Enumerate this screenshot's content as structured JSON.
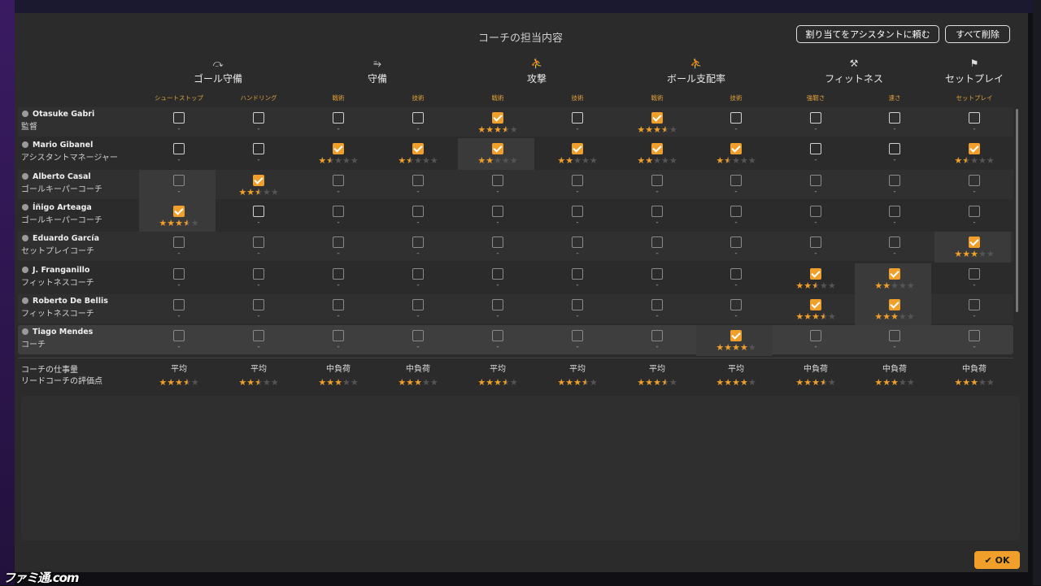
{
  "title": "コーチの担当内容",
  "buttons": {
    "assign_assistant": "割り当てをアシスタントに頼む",
    "delete_all": "すべて削除",
    "ok": "OK",
    "ok_icon": "✔"
  },
  "watermark": "ファミ通.com",
  "categories": [
    {
      "label": "ゴール守備",
      "icon": "goalkeeper-icon",
      "glyph": "⤼"
    },
    {
      "label": "守備",
      "icon": "tackle-icon",
      "glyph": "⥱"
    },
    {
      "label": "攻撃",
      "icon": "running-icon",
      "glyph": "⛹"
    },
    {
      "label": "ボール支配率",
      "icon": "possession-icon",
      "glyph": "⛹"
    },
    {
      "label": "フィットネス",
      "icon": "dumbbell-icon",
      "glyph": "⚒"
    },
    {
      "label": "セットプレイ",
      "icon": "corner-flag-icon",
      "glyph": "⚑"
    }
  ],
  "subcolumns": [
    "シュートストップ",
    "ハンドリング",
    "戦術",
    "技術",
    "戦術",
    "技術",
    "戦術",
    "技術",
    "強靭さ",
    "速さ",
    "セットプレイ"
  ],
  "coaches": [
    {
      "name": "Otasuke Gabri",
      "role": "監督",
      "checked": [
        0,
        0,
        0,
        0,
        1,
        0,
        1,
        0,
        0,
        0,
        0
      ],
      "rating": [
        null,
        null,
        null,
        null,
        3.5,
        null,
        3.5,
        null,
        null,
        null,
        null
      ]
    },
    {
      "name": "Mario Gibanel",
      "role": "アシスタントマネージャー",
      "checked": [
        0,
        0,
        1,
        1,
        1,
        1,
        1,
        1,
        0,
        0,
        1
      ],
      "rating": [
        null,
        null,
        1.5,
        1.5,
        2,
        2,
        2,
        1.5,
        null,
        null,
        1.5
      ]
    },
    {
      "name": "Alberto Casal",
      "role": "ゴールキーパーコーチ",
      "checked": [
        0,
        1,
        0,
        0,
        0,
        0,
        0,
        0,
        0,
        0,
        0
      ],
      "rating": [
        null,
        2.5,
        null,
        null,
        null,
        null,
        null,
        null,
        null,
        null,
        null
      ]
    },
    {
      "name": "Íñigo Arteaga",
      "role": "ゴールキーパーコーチ",
      "checked": [
        1,
        0,
        0,
        0,
        0,
        0,
        0,
        0,
        0,
        0,
        0
      ],
      "rating": [
        3.5,
        null,
        null,
        null,
        null,
        null,
        null,
        null,
        null,
        null,
        null
      ]
    },
    {
      "name": "Eduardo García",
      "role": "セットプレイコーチ",
      "checked": [
        0,
        0,
        0,
        0,
        0,
        0,
        0,
        0,
        0,
        0,
        1
      ],
      "rating": [
        null,
        null,
        null,
        null,
        null,
        null,
        null,
        null,
        null,
        null,
        3
      ]
    },
    {
      "name": "J. Franganillo",
      "role": "フィットネスコーチ",
      "checked": [
        0,
        0,
        0,
        0,
        0,
        0,
        0,
        0,
        1,
        1,
        0
      ],
      "rating": [
        null,
        null,
        null,
        null,
        null,
        null,
        null,
        null,
        2.5,
        2,
        null
      ]
    },
    {
      "name": "Roberto De Bellis",
      "role": "フィットネスコーチ",
      "checked": [
        0,
        0,
        0,
        0,
        0,
        0,
        0,
        0,
        1,
        1,
        0
      ],
      "rating": [
        null,
        null,
        null,
        null,
        null,
        null,
        null,
        null,
        3.5,
        3,
        null
      ]
    },
    {
      "name": "Tiago Mendes",
      "role": "コーチ",
      "checked": [
        0,
        0,
        0,
        0,
        0,
        0,
        0,
        1,
        0,
        0,
        0
      ],
      "rating": [
        null,
        null,
        null,
        null,
        null,
        null,
        null,
        4,
        null,
        null,
        null
      ]
    }
  ],
  "footer": {
    "workload_label": "コーチの仕事量",
    "rating_label": "リードコーチの評価点",
    "workload": [
      "平均",
      "平均",
      "中負荷",
      "中負荷",
      "平均",
      "平均",
      "平均",
      "平均",
      "中負荷",
      "中負荷",
      "中負荷"
    ],
    "lead_rating": [
      3.5,
      2.5,
      3,
      3,
      3.5,
      3.5,
      3.5,
      4,
      3.5,
      3,
      3
    ]
  },
  "no_rating_mark": "-",
  "colors": {
    "accent": "#f0a02a",
    "modal_bg": "#2b2b2b"
  }
}
